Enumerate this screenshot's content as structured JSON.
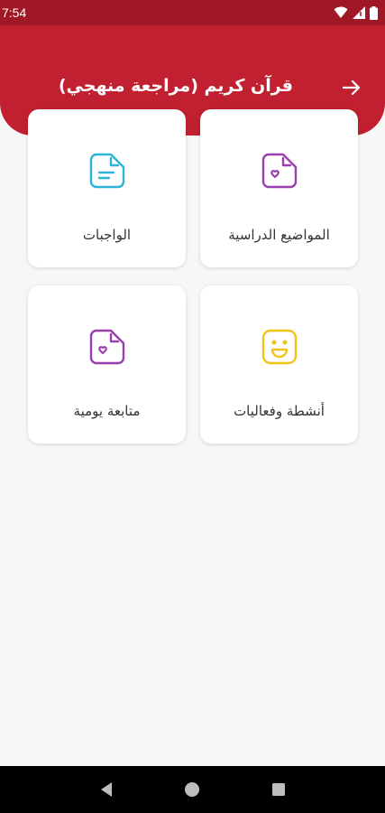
{
  "status_bar": {
    "time": "7:54",
    "icons": [
      "wifi-icon",
      "signal-icon",
      "battery-icon"
    ]
  },
  "header": {
    "title": "قرآن كريم (مراجعة منهجي)",
    "back_icon": "arrow-right-icon",
    "color": "#c0202f"
  },
  "cards": [
    {
      "label": "المواضيع الدراسية",
      "icon": "document-heart-icon",
      "color": "#9b3fb0"
    },
    {
      "label": "الواجبات",
      "icon": "document-lines-icon",
      "color": "#2bb3d8"
    },
    {
      "label": "أنشطة وفعاليات",
      "icon": "smiley-icon",
      "color": "#f0c419"
    },
    {
      "label": "متابعة يومية",
      "icon": "document-heart-icon",
      "color": "#9b3fb0"
    }
  ],
  "nav_bar": {
    "buttons": [
      "back-triangle-icon",
      "home-circle-icon",
      "recents-square-icon"
    ]
  }
}
